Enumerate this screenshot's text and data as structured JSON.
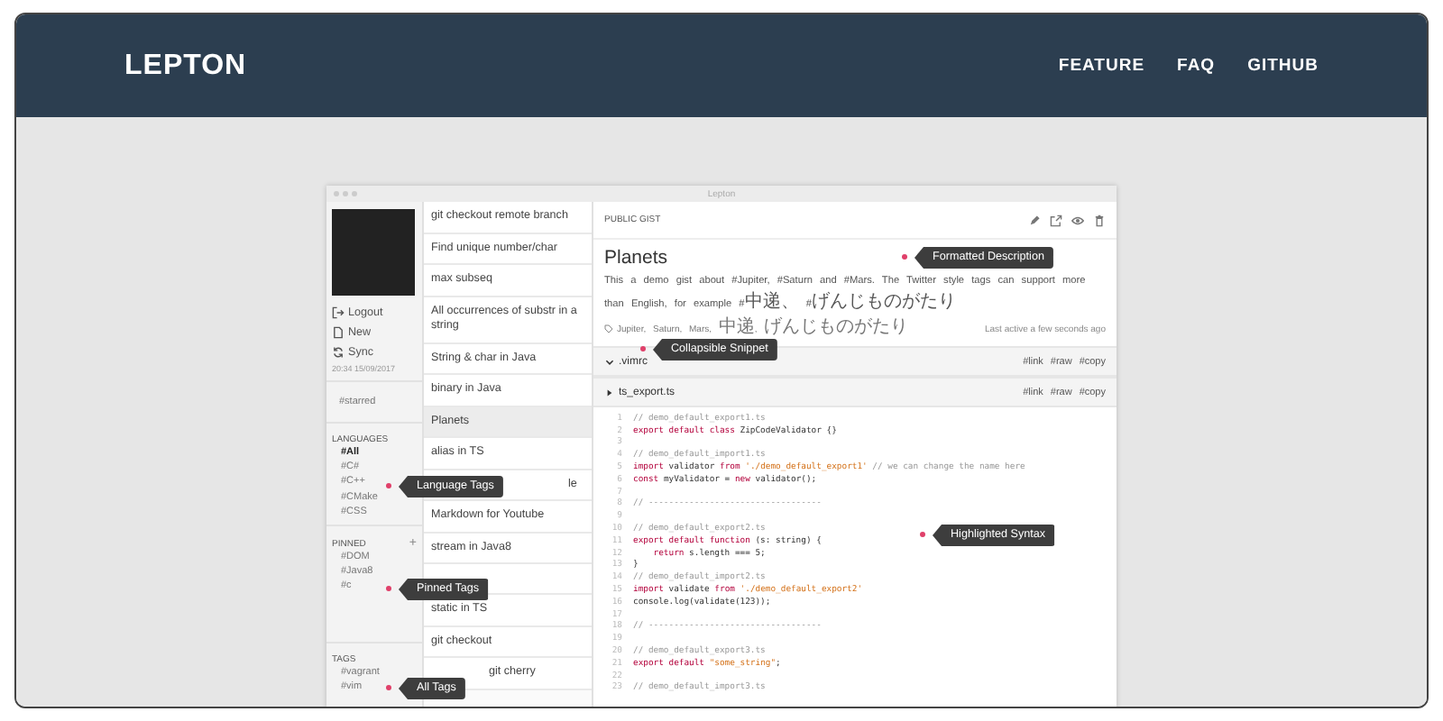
{
  "site": {
    "logo": "LEPTON",
    "nav": [
      "FEATURE",
      "FAQ",
      "GITHUB"
    ]
  },
  "window": {
    "title": "Lepton"
  },
  "sidebar": {
    "actions": [
      {
        "kind": "logout",
        "label": "Logout"
      },
      {
        "kind": "new",
        "label": "New"
      },
      {
        "kind": "sync",
        "label": "Sync"
      }
    ],
    "sync_time": "20:34 15/09/2017",
    "starred": "#starred",
    "languages": {
      "heading": "LANGUAGES",
      "items": [
        {
          "label": "#All",
          "selected": true
        },
        {
          "label": "#C#",
          "selected": false
        },
        {
          "label": "#C++",
          "selected": false
        },
        {
          "label": "#CMake",
          "selected": false
        },
        {
          "label": "#CSS",
          "selected": false
        }
      ]
    },
    "pinned": {
      "heading": "PINNED",
      "add": "+",
      "items": [
        "#DOM",
        "#Java8",
        "#c"
      ]
    },
    "tags": {
      "heading": "TAGS",
      "items": [
        "#vagrant",
        "#vim"
      ]
    }
  },
  "gist_list": [
    {
      "kind": "text",
      "title": "git checkout remote branch",
      "selected": false
    },
    {
      "kind": "text",
      "title": "Find unique number/char",
      "selected": false
    },
    {
      "kind": "text",
      "title": "max subseq",
      "selected": false
    },
    {
      "kind": "text",
      "title": "All occurrences of substr in a string",
      "selected": false
    },
    {
      "kind": "text",
      "title": "String & char in Java",
      "selected": false
    },
    {
      "kind": "text",
      "title": "binary in Java",
      "selected": false
    },
    {
      "kind": "text",
      "title": "Planets",
      "selected": true
    },
    {
      "kind": "text",
      "title": "alias in TS",
      "selected": false
    },
    {
      "kind": "partly_covered",
      "title": "le",
      "selected": false
    },
    {
      "kind": "text",
      "title": "Markdown for Youtube",
      "selected": false
    },
    {
      "kind": "text",
      "title": "stream in Java8",
      "selected": false
    },
    {
      "kind": "covered",
      "selected": false
    },
    {
      "kind": "text",
      "title": "static in TS",
      "selected": false
    },
    {
      "kind": "text",
      "title": "git checkout",
      "selected": false
    },
    {
      "kind": "partly_covered",
      "title": "git cherry",
      "selected": false
    }
  ],
  "gist": {
    "visibility": "PUBLIC GIST",
    "title": "Planets",
    "description": "This a demo gist about #Jupiter, #Saturn and #Mars. The Twitter style tags can support more than English, for example #中递、 #げんじものがたり",
    "tags": "Jupiter, Saturn, Mars, 中递, げんじものがたり",
    "last_active": "Last active a few seconds ago",
    "snippets": [
      {
        "filename": ".vimrc",
        "expanded": false,
        "actions": [
          "#link",
          "#raw",
          "#copy"
        ]
      },
      {
        "filename": "ts_export.ts",
        "expanded": true,
        "actions": [
          "#link",
          "#raw",
          "#copy"
        ],
        "lines": [
          {
            "n": "1",
            "tokens": [
              {
                "kind": "comment",
                "text": "// demo_default_export1.ts"
              }
            ]
          },
          {
            "n": "2",
            "tokens": [
              {
                "kind": "keyword",
                "text": "export default class "
              },
              {
                "kind": "plain",
                "text": "ZipCodeValidator {}"
              }
            ]
          },
          {
            "n": "3"
          },
          {
            "n": "4",
            "tokens": [
              {
                "kind": "comment",
                "text": "// demo_default_import1.ts"
              }
            ]
          },
          {
            "n": "5",
            "tokens": [
              {
                "kind": "keyword",
                "text": "import "
              },
              {
                "kind": "plain",
                "text": "validator "
              },
              {
                "kind": "keyword",
                "text": "from "
              },
              {
                "kind": "string",
                "text": "'./demo_default_export1'"
              },
              {
                "kind": "comment",
                "text": " // we can change the name here"
              }
            ]
          },
          {
            "n": "6",
            "tokens": [
              {
                "kind": "keyword",
                "text": "const "
              },
              {
                "kind": "plain",
                "text": "myValidator = "
              },
              {
                "kind": "keyword",
                "text": "new "
              },
              {
                "kind": "plain",
                "text": "validator();"
              }
            ]
          },
          {
            "n": "7"
          },
          {
            "n": "8",
            "tokens": [
              {
                "kind": "comment",
                "text": "// ----------------------------------"
              }
            ]
          },
          {
            "n": "9"
          },
          {
            "n": "10",
            "tokens": [
              {
                "kind": "comment",
                "text": "// demo_default_export2.ts"
              }
            ]
          },
          {
            "n": "11",
            "tokens": [
              {
                "kind": "keyword",
                "text": "export default function "
              },
              {
                "kind": "plain",
                "text": "(s: string) {"
              }
            ]
          },
          {
            "n": "12",
            "tokens": [
              {
                "kind": "keyword",
                "text": "    return "
              },
              {
                "kind": "plain",
                "text": "s.length === 5;"
              }
            ]
          },
          {
            "n": "13",
            "tokens": [
              {
                "kind": "plain",
                "text": "}"
              }
            ]
          },
          {
            "n": "14",
            "tokens": [
              {
                "kind": "comment",
                "text": "// demo_default_import2.ts"
              }
            ]
          },
          {
            "n": "15",
            "tokens": [
              {
                "kind": "keyword",
                "text": "import "
              },
              {
                "kind": "plain",
                "text": "validate "
              },
              {
                "kind": "keyword",
                "text": "from "
              },
              {
                "kind": "string",
                "text": "'./demo_default_export2'"
              }
            ]
          },
          {
            "n": "16",
            "tokens": [
              {
                "kind": "plain",
                "text": "console.log(validate(123));"
              }
            ]
          },
          {
            "n": "17"
          },
          {
            "n": "18",
            "tokens": [
              {
                "kind": "comment",
                "text": "// ----------------------------------"
              }
            ]
          },
          {
            "n": "19"
          },
          {
            "n": "20",
            "tokens": [
              {
                "kind": "comment",
                "text": "// demo_default_export3.ts"
              }
            ]
          },
          {
            "n": "21",
            "tokens": [
              {
                "kind": "keyword",
                "text": "export default "
              },
              {
                "kind": "string",
                "text": "\"some_string\""
              },
              {
                "kind": "plain",
                "text": ";"
              }
            ]
          },
          {
            "n": "22"
          },
          {
            "n": "23",
            "tokens": [
              {
                "kind": "comment",
                "text": "// demo_default_import3.ts"
              }
            ]
          }
        ]
      }
    ]
  },
  "annotations": [
    "Formatted Description",
    "Collapsible Snippet",
    "Highlighted Syntax",
    "Language Tags",
    "Pinned Tags",
    "All Tags"
  ]
}
